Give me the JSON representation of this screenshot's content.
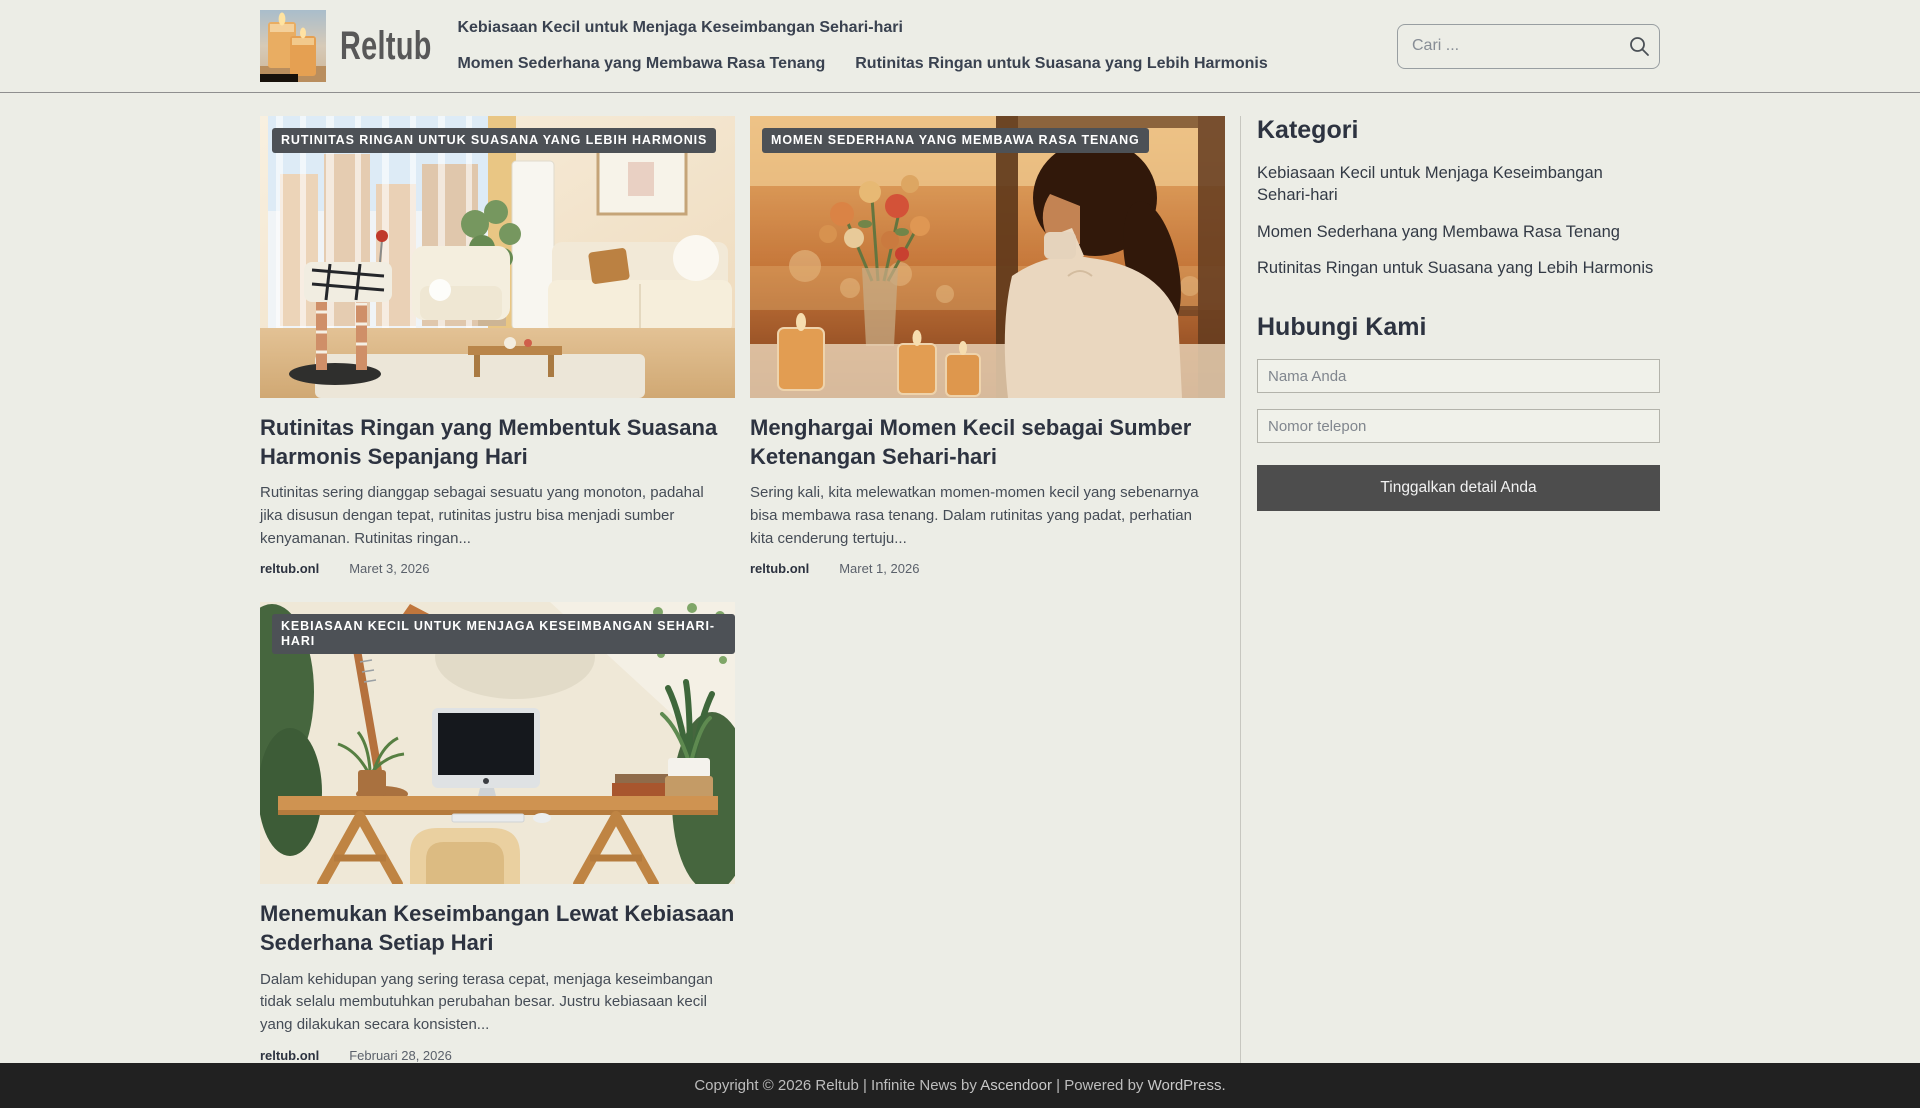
{
  "header": {
    "site_name": "Reltub",
    "nav_items": [
      {
        "label": "Kebiasaan Kecil untuk Menjaga Keseimbangan Sehari-hari"
      },
      {
        "label": "Momen Sederhana yang Membawa Rasa Tenang"
      },
      {
        "label": "Rutinitas Ringan untuk Suasana yang Lebih Harmonis"
      }
    ],
    "search": {
      "placeholder": "Cari ...",
      "icon": "search-icon"
    }
  },
  "articles": [
    {
      "badge": "RUTINITAS RINGAN UNTUK SUASANA YANG LEBIH HARMONIS",
      "title": "Rutinitas Ringan yang Membentuk Suasana Harmonis Sepanjang Hari",
      "excerpt": "Rutinitas sering dianggap sebagai sesuatu yang monoton, padahal jika disusun dengan tepat, rutinitas justru bisa menjadi sumber kenyamanan. Rutinitas ringan...",
      "author": "reltub.onl",
      "date": "Maret 3, 2026",
      "image_alt": "cozy-cream-living-room-with-sofa-plant-cat-tree-and-city-window"
    },
    {
      "badge": "MOMEN SEDERHANA YANG MEMBAWA RASA TENANG",
      "title": "Menghargai Momen Kecil sebagai Sumber Ketenangan Sehari-hari",
      "excerpt": "Sering kali, kita melewatkan momen-momen kecil yang sebenarnya bisa membawa rasa tenang. Dalam rutinitas yang padat, perhatian kita cenderung tertuju...",
      "author": "reltub.onl",
      "date": "Maret 1, 2026",
      "image_alt": "woman-drinking-from-cup-at-golden-hour-window-with-flowers-and-candles"
    },
    {
      "badge": "KEBIASAAN KECIL UNTUK MENJAGA KESEIMBANGAN SEHARI-HARI",
      "title": "Menemukan Keseimbangan Lewat Kebiasaan Sederhana Setiap Hari",
      "excerpt": "Dalam kehidupan yang sering terasa cepat, menjaga keseimbangan tidak selalu membutuhkan perubahan besar. Justru kebiasaan kecil yang dilakukan secara konsisten...",
      "author": "reltub.onl",
      "date": "Februari 28, 2026",
      "image_alt": "wooden-home-office-desk-with-imac-plants-and-lamp"
    }
  ],
  "sidebar": {
    "categories_title": "Kategori",
    "categories": [
      {
        "label": "Kebiasaan Kecil untuk Menjaga Keseimbangan Sehari-hari"
      },
      {
        "label": "Momen Sederhana yang Membawa Rasa Tenang"
      },
      {
        "label": "Rutinitas Ringan untuk Suasana yang Lebih Harmonis"
      }
    ],
    "contact_title": "Hubungi Kami",
    "form": {
      "name_placeholder": "Nama Anda",
      "phone_placeholder": "Nomor telepon",
      "submit_label": "Tinggalkan detail Anda"
    }
  },
  "footer": {
    "copyright_prefix": "Copyright © 2026 Reltub | Infinite News by ",
    "theme_link": "Ascendoor",
    "powered_separator": " | Powered by ",
    "platform_link": "WordPress."
  },
  "colors": {
    "page_bg": "#ecede6",
    "badge_bg": "#4d5156",
    "button_bg": "#4d4d4d",
    "footer_bg": "#212121",
    "heading_text": "#2d3340"
  }
}
